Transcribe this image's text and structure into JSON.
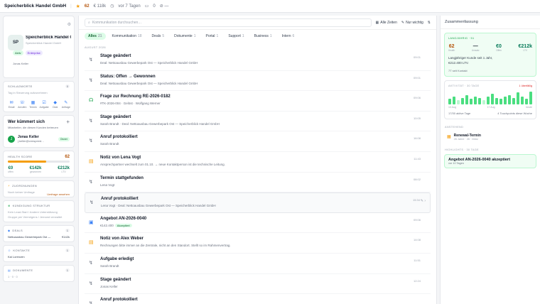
{
  "topbar": {
    "company": "Speicherblick Handel GmbH",
    "score": "62",
    "revenue": "€ 118k",
    "last_contact": "vor 7 Tagen",
    "notes": "0",
    "more": "⊘ —"
  },
  "profile": {
    "initials": "SP",
    "name": "Speicherblick Handel G…",
    "subtitle": "Speicherblick Handel GmbH",
    "badge_active": "Aktiv",
    "badge_segment": "Enterprise",
    "owner_line": "Jonas Keller"
  },
  "sections": {
    "tags": {
      "label": "Schlagworte",
      "count": "0",
      "text": "Tag in Steuerung aufzunehmen"
    },
    "actions": [
      "Email",
      "Anrufen",
      "Termin",
      "Aufgabe",
      "Deal",
      "Anfrage"
    ],
    "who": {
      "title": "Wer kümmert sich",
      "text": "Mitarbeiter, die diesen Kunden betreuen",
      "avatar": "J",
      "name": "Jonas Keller",
      "email": "j.keller@crmspeed…",
      "role": "Owner"
    },
    "health": {
      "label": "Health Score",
      "value": "62",
      "fill": 0.62
    },
    "kpis": [
      {
        "value": "€0",
        "label": "offen"
      },
      {
        "value": "€142k",
        "label": "gewonnen"
      },
      {
        "value": "€212k",
        "label": "LTV"
      }
    ],
    "assign": {
      "label": "Zuordnungen",
      "text": "Noch keiner Umfrage",
      "link": "Umfrage ansehen"
    },
    "relations": {
      "label": "Kündigung Struktur",
      "line1": "Kein Lead-Start / Andere Unterstützung",
      "line2": "Gruppe per Vermögens / Jemand verwaltet"
    },
    "deals": {
      "label": "Deals",
      "count": "1",
      "row": "Nettoausbau Gewerbepark Ost —",
      "amount": "€142k"
    },
    "contacts": {
      "label": "Kontakte",
      "count": "1",
      "row": "Kai Lorenzen"
    },
    "documents": {
      "label": "Dokumente",
      "count": "1",
      "row": "1 · 0 · 0"
    }
  },
  "main": {
    "search_placeholder": "Kommunikation durchsuchen…",
    "filter_all": "Alle Zeiten",
    "filter_important": "Nur wichtig",
    "tabs": [
      {
        "label": "Alles",
        "count": "21"
      },
      {
        "label": "Kommunikation",
        "count": "18"
      },
      {
        "label": "Deals",
        "count": "5"
      },
      {
        "label": "Dokumente",
        "count": "1"
      },
      {
        "label": "Portal",
        "count": "1"
      },
      {
        "label": "Support",
        "count": "1"
      },
      {
        "label": "Business",
        "count": "1"
      },
      {
        "label": "Intern",
        "count": "6"
      }
    ],
    "month": "August 2026",
    "items": [
      {
        "title": "Stage geändert",
        "sub": "Deal: Nettoausbau Gewerbepark Ost — Speicherblick Handel GmbH",
        "time": "09:01",
        "icon": "↯",
        "kind": ""
      },
      {
        "title": "Status: Offen → Gewonnen",
        "sub": "Deal: Nettoausbau Gewerbepark Ost — Speicherblick Handel GmbH",
        "time": "09:01",
        "icon": "↯",
        "kind": ""
      },
      {
        "title": "Frage zur Rechnung RE-2026-0182",
        "sub": "#TK-2026-004 · Gelöst · Wolfgang Werner",
        "time": "09:06",
        "icon": "☊",
        "kind": "hs"
      },
      {
        "title": "Stage geändert",
        "sub": "Sarah Brandt · Deal: Nettoausbau Gewerbepark Ost — Speicherblick Handel GmbH",
        "time": "10:05",
        "icon": "↯",
        "kind": ""
      },
      {
        "title": "Anruf protokolliert",
        "sub": "Sarah Brandt",
        "time": "16:08",
        "icon": "↯",
        "kind": ""
      },
      {
        "title": "Notiz von Lena Vogt",
        "sub": "Ansprechpartner wechselt zum 01.10. → neue Kontaktperson ist die technische Leitung.",
        "time": "11:43",
        "icon": "▤",
        "kind": "note"
      },
      {
        "title": "Termin stattgefunden",
        "sub": "Lena Vogt",
        "time": "08:02",
        "icon": "↯",
        "kind": ""
      },
      {
        "title": "Anruf protokolliert",
        "sub": "Lena Vogt · Deal: Nettoausbau Gewerbepark Ost — Speicherblick Handel GmbH",
        "time": "15:34",
        "icon": "↯",
        "kind": "",
        "hl": true
      },
      {
        "title": "Angebot AN-2026-0040",
        "sub": "€142.400",
        "status": "Akzeptiert",
        "time": "09:06",
        "icon": "▣",
        "kind": "doc"
      },
      {
        "title": "Notiz von Alex Weber",
        "sub": "Rechnungen bitte immer an die Zentrale, nicht an den Standort. Stellt so im Rahmenvertrag.",
        "time": "14:08",
        "icon": "▤",
        "kind": "note"
      },
      {
        "title": "Aufgabe erledigt",
        "sub": "Sarah Brandt",
        "time": "11:51",
        "icon": "↯",
        "kind": ""
      },
      {
        "title": "Stage geändert",
        "sub": "Jonas Keller",
        "time": "12:24",
        "icon": "↯",
        "kind": ""
      },
      {
        "title": "Anruf protokolliert",
        "sub": "",
        "time": "",
        "icon": "↯",
        "kind": ""
      }
    ]
  },
  "right": {
    "title": "Zusammenfassung",
    "summary": {
      "label": "Langjährig · 51",
      "stats": [
        {
          "value": "62",
          "label": "Health",
          "amber": true
        },
        {
          "value": "—",
          "label": "Umsatz"
        },
        {
          "value": "€0",
          "label": "Offen"
        },
        {
          "value": "€212k",
          "label": "LTV"
        }
      ],
      "text1": "Langjähriger Kunde seit 1 Jahr,",
      "text2": "€212.400 LTV.",
      "text3": "7T seit Kontakt"
    },
    "activity": {
      "label": "Aktivität · 30 Tage",
      "flag": "1 überfällig",
      "bars": [
        0.4,
        0.6,
        0.3,
        0.5,
        0.7,
        0.4,
        0.6,
        0.5,
        0.3,
        0.6,
        0.8,
        0.5,
        0.4,
        0.6,
        0.7,
        0.5,
        0.9,
        0.6,
        0.4,
        1.0
      ],
      "axis_start": "10 Aug",
      "axis_mid": "17 Aug",
      "axis_end": "heute",
      "foot_left": "17/30 aktive Tage",
      "foot_right": "4 Touchpoints diese Woche"
    },
    "upcoming": {
      "label": "Anstehend",
      "title": "Renewal-Termin",
      "sub": "26 Jahre · 26 · März"
    },
    "highlights": {
      "label": "Highlights · 30 Tage",
      "title": "Angebot AN-2026-0040 akzeptiert",
      "sub": "vor 10 Tagen"
    }
  }
}
